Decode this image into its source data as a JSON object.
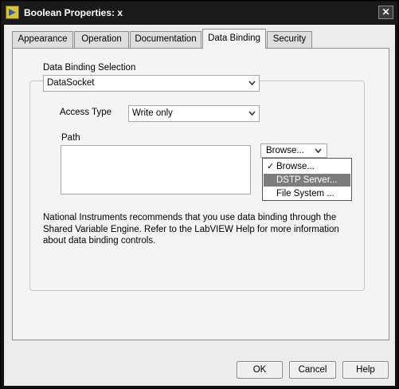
{
  "window": {
    "title": "Boolean Properties: x",
    "close_glyph": "✕"
  },
  "tabs": [
    {
      "label": "Appearance",
      "active": false
    },
    {
      "label": "Operation",
      "active": false
    },
    {
      "label": "Documentation",
      "active": false
    },
    {
      "label": "Data Binding",
      "active": true
    },
    {
      "label": "Security",
      "active": false
    }
  ],
  "data_binding": {
    "selection_label": "Data Binding Selection",
    "selection_value": "DataSocket",
    "access_type_label": "Access Type",
    "access_type_value": "Write only",
    "path_label": "Path",
    "path_value": "",
    "browse_label": "Browse...",
    "browse_menu": [
      {
        "label": "Browse...",
        "checked": true,
        "highlighted": false
      },
      {
        "label": "DSTP Server...",
        "checked": false,
        "highlighted": true
      },
      {
        "label": "File System ...",
        "checked": false,
        "highlighted": false
      }
    ],
    "note": "National Instruments recommends that you use data binding through the Shared Variable Engine.  Refer to the LabVIEW Help for more information about data binding controls."
  },
  "buttons": {
    "ok": "OK",
    "cancel": "Cancel",
    "help": "Help"
  },
  "colors": {
    "titlebar": "#1a1a1a",
    "menu_highlight": "#7c7c7c",
    "dialog_bg": "#ececec"
  }
}
